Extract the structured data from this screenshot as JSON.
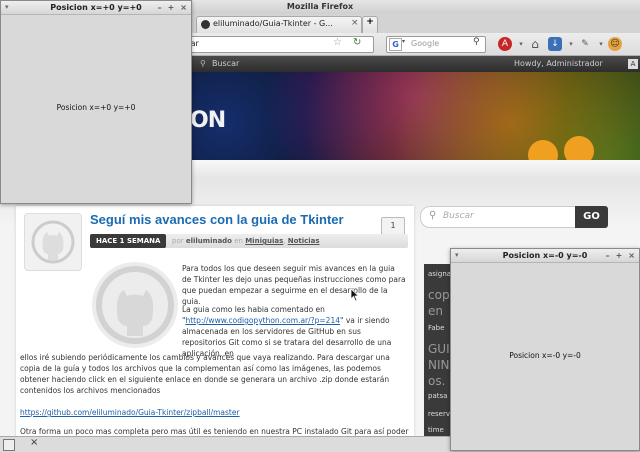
{
  "firefox": {
    "window_title": "Mozilla Firefox",
    "tab_label": "eliluminado/Guia-Tkinter - G...",
    "url_fragment": "n.ar",
    "search_placeholder": "Google",
    "new_tab": "+",
    "close_tab": "×"
  },
  "adminbar": {
    "search_label": "Buscar",
    "greeting": "Howdy, Administrador"
  },
  "site": {
    "logo_text": "ON"
  },
  "post": {
    "title": "Seguí mis avances con la guia de Tkinter",
    "comment_count": "1",
    "date_badge": "HACE 1 SEMANA",
    "by_prefix": "por",
    "author": "eliluminado",
    "in_word": "en",
    "category1": "Miniguias",
    "category2": "Noticias",
    "para1": "Para todos los que deseen seguir mis avances en la guia de Tkinter les dejo unas pequeñas instrucciones como para que puedan empezar a seguirme en el desarrollo de la guia.",
    "para2_lead": "La guia como les habia comentado en",
    "para2_link": "http://www.codigopython.com.ar/?p=214",
    "para2_rest": "va ir siendo almacenada en los servidores de GitHub en sus repositorios Git como si se tratara del desarrollo de una aplicación, en",
    "para2_wide": "ellos iré subiendo periódicamente los cambios y avances que vaya realizando. Para descargar una copia de la guía y todos los archivos que la complementan así como las imágenes, las podemos obtener haciendo click en el siguiente enlace en donde se generara un archivo .zip donde estarán contenidos los archivos mencionados",
    "zip_link": "https://github.com/eliluminado/Guia-Tkinter/zipball/master",
    "para3": "Otra forma un poco mas completa pero mas útil es teniendo en nuestra PC instalado Git para así poder"
  },
  "search": {
    "placeholder": "Buscar",
    "button": "GO"
  },
  "sidebar": {
    "lines": [
      "asigna",
      "cop",
      "en",
      "Fabe",
      "GUI",
      "NIN",
      "os.",
      "patsa",
      "reserv",
      "time"
    ]
  },
  "tk_left": {
    "title": "Posicion x=+0 y=+0",
    "label": "Posicion x=+0 y=+0"
  },
  "tk_right": {
    "title": "Posicion x=-0 y=-0",
    "label": "Posicion x=-0 y=-0"
  },
  "taskbar": {
    "close": "×"
  },
  "colors": {
    "link": "#1b6bb2",
    "dark_badge": "#3a3a3a"
  }
}
